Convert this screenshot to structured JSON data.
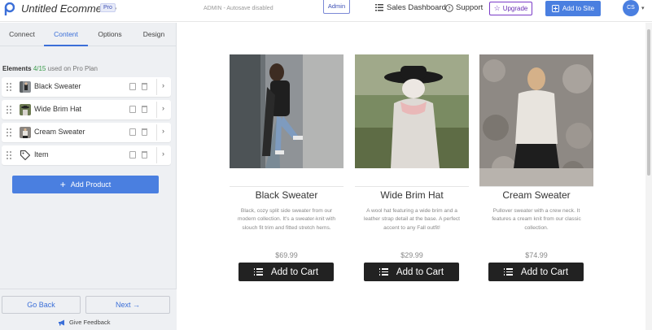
{
  "app": {
    "title": "Untitled Ecommerce",
    "plan_badge": "Pro",
    "autosave_status": "ADMIN - Autosave disabled",
    "admin_label": "Admin",
    "sales_dashboard": "Sales Dashboard",
    "support": "Support",
    "upgrade": "Upgrade",
    "add_to_site": "Add to Site",
    "user_initials": "CS",
    "brand_color": "#4a7fe0"
  },
  "sidebar": {
    "tabs": [
      {
        "label": "Connect"
      },
      {
        "label": "Content",
        "active": true
      },
      {
        "label": "Options"
      },
      {
        "label": "Design"
      }
    ],
    "elements_header": {
      "label": "Elements",
      "count": "4/15",
      "plan_text": "used on Pro Plan"
    },
    "items": [
      {
        "label": "Black Sweater",
        "thumb": "black-sweater-thumb"
      },
      {
        "label": "Wide Brim Hat",
        "thumb": "hat-thumb"
      },
      {
        "label": "Cream Sweater",
        "thumb": "cream-sweater-thumb"
      },
      {
        "label": "Item",
        "thumb": "tag-icon"
      }
    ],
    "add_product": "Add Product",
    "back": "Go Back",
    "next": "Next",
    "feedback": "Give Feedback"
  },
  "products": [
    {
      "title": "Black Sweater",
      "description": "Black, cozy split side sweater from our modern collection. It's a sweater-knit with slouch fit trim and fitted stretch hems.",
      "price": "$69.99",
      "button": "Add to Cart"
    },
    {
      "title": "Wide Brim Hat",
      "description": "A wool hat featuring a wide brim and a leather strap detail at the base. A perfect accent to any Fall outfit!",
      "price": "$29.99",
      "button": "Add to Cart"
    },
    {
      "title": "Cream Sweater",
      "description": "Pullover sweater with a crew neck. It features a cream knit from our classic collection.",
      "price": "$74.99",
      "button": "Add to Cart"
    }
  ]
}
